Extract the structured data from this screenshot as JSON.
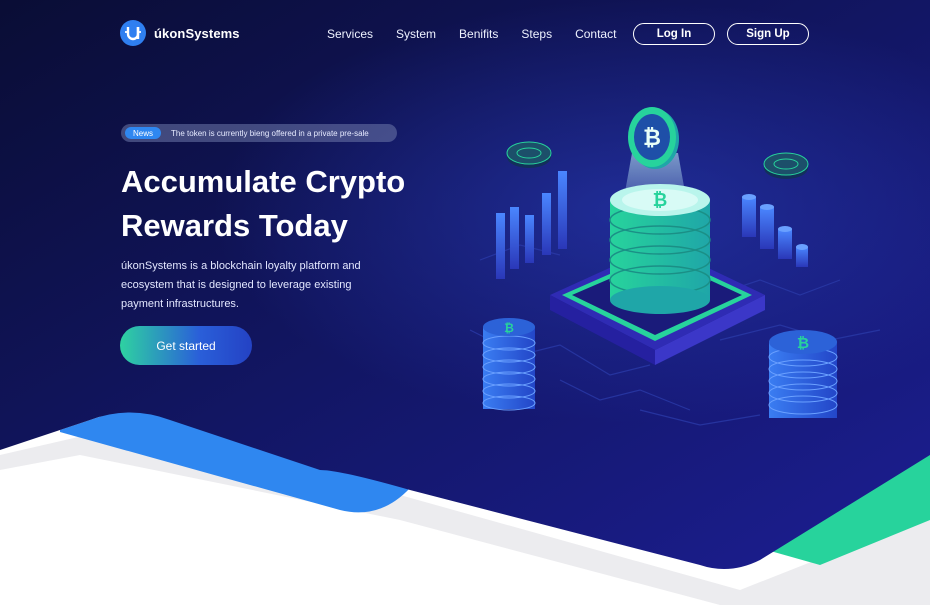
{
  "brand": {
    "name": "úkonSystems"
  },
  "nav": {
    "items": [
      "Services",
      "System",
      "Benifits",
      "Steps",
      "Contact"
    ]
  },
  "auth": {
    "login_label": "Log In",
    "signup_label": "Sign Up"
  },
  "hero": {
    "news_badge": "News",
    "news_text": "The token is currently bieng offered in a private pre-sale",
    "title_line1": "Accumulate Crypto",
    "title_line2": "Rewards Today",
    "description": "úkonSystems is a blockchain loyalty platform and ecosystem that is designed to leverage existing payment infrastructures.",
    "cta_label": "Get started"
  },
  "colors": {
    "bg_dark": "#0b0f3f",
    "bg_mid": "#1a1e8a",
    "accent_blue": "#2f87f0",
    "accent_green": "#27d39c"
  },
  "icons": [
    "logo-u-icon",
    "bitcoin-icon"
  ]
}
